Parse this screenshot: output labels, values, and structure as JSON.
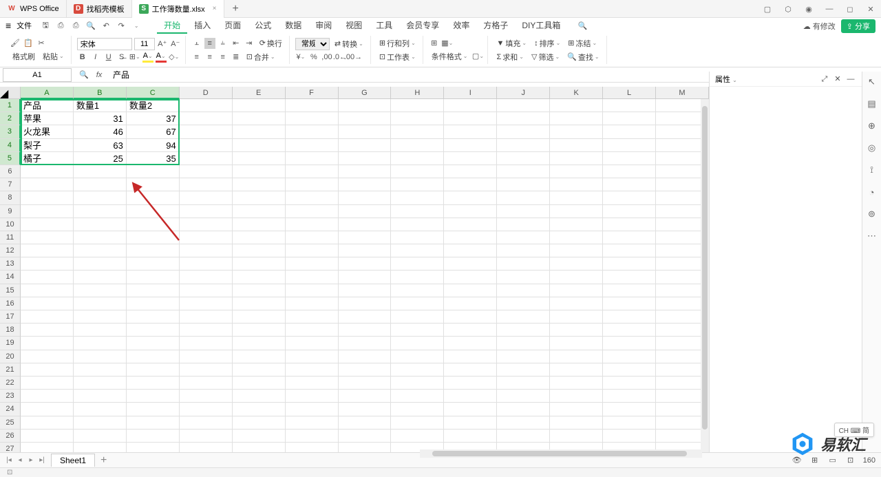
{
  "titlebar": {
    "tabs": [
      {
        "icon": "W",
        "label": "WPS Office",
        "class": "wps"
      },
      {
        "icon": "D",
        "label": "找稻壳模板",
        "class": "doc"
      },
      {
        "icon": "S",
        "label": "工作簿数量.xlsx",
        "class": "sheet",
        "active": true
      }
    ]
  },
  "menu": {
    "file": "文件",
    "tabs": [
      "开始",
      "插入",
      "页面",
      "公式",
      "数据",
      "审阅",
      "视图",
      "工具",
      "会员专享",
      "效率",
      "方格子",
      "DIY工具箱"
    ],
    "pending": "有修改",
    "share": "分享"
  },
  "ribbon": {
    "format_painter": "格式刷",
    "paste": "粘贴",
    "font_name": "宋体",
    "font_size": "11",
    "number_format": "常规",
    "wrap": "换行",
    "merge": "合并",
    "convert": "转换",
    "row_col": "行和列",
    "worksheet": "工作表",
    "cond_format": "条件格式",
    "fill": "填充",
    "sort": "排序",
    "freeze": "冻结",
    "sum": "求和",
    "filter": "筛选",
    "find": "查找"
  },
  "formula_bar": {
    "name_box": "A1",
    "formula": "产品"
  },
  "columns": [
    "A",
    "B",
    "C",
    "D",
    "E",
    "F",
    "G",
    "H",
    "I",
    "J",
    "K",
    "L",
    "M"
  ],
  "chart_data": {
    "type": "table",
    "headers": [
      "产品",
      "数量1",
      "数量2"
    ],
    "rows": [
      {
        "product": "苹果",
        "qty1": 31,
        "qty2": 37
      },
      {
        "product": "火龙果",
        "qty1": 46,
        "qty2": 67
      },
      {
        "product": "梨子",
        "qty1": 63,
        "qty2": 94
      },
      {
        "product": "橘子",
        "qty1": 25,
        "qty2": 35
      }
    ]
  },
  "side_panel": {
    "title": "属性"
  },
  "sheet_tab": "Sheet1",
  "status": {
    "zoom": "160",
    "ime": "CH ⌨ 简"
  },
  "watermark": "易软汇"
}
